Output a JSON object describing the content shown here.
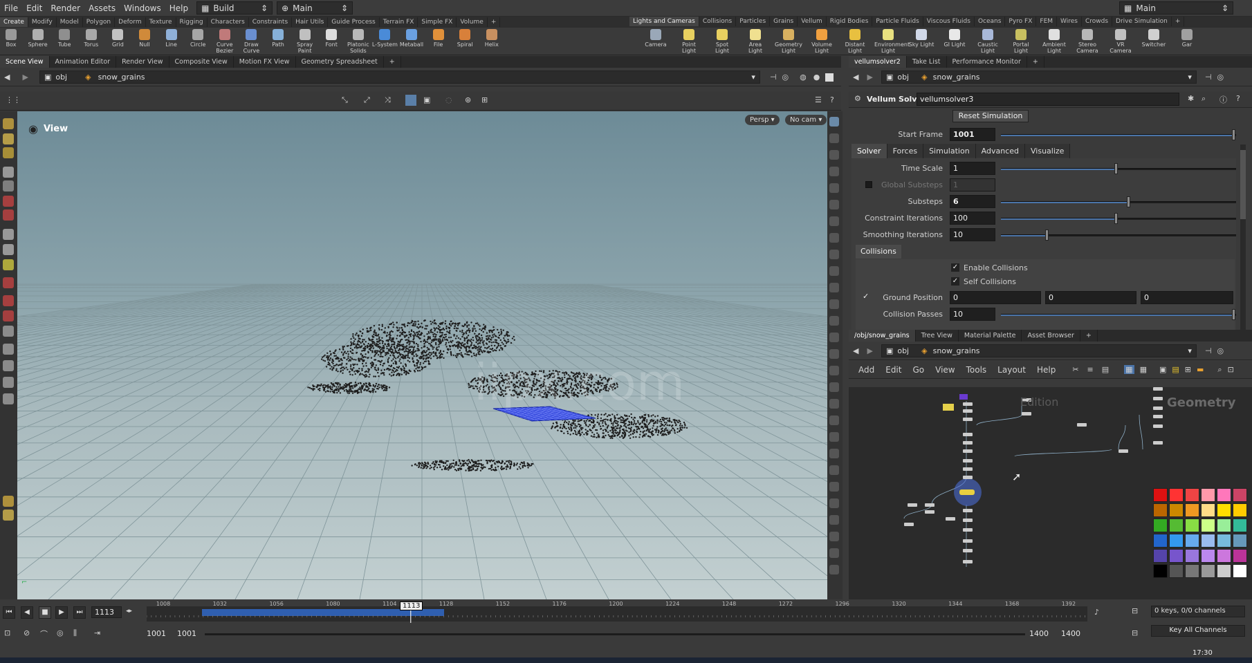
{
  "menubar": {
    "items": [
      "File",
      "Edit",
      "Render",
      "Assets",
      "Windows",
      "Help"
    ],
    "desktop": "Build",
    "session": "Main",
    "right_session": "Main"
  },
  "shelf_left": {
    "tabs": [
      "Create",
      "Modify",
      "Model",
      "Polygon",
      "Deform",
      "Texture",
      "Rigging",
      "Characters",
      "Constraints",
      "Hair Utils",
      "Guide Process",
      "Terrain FX",
      "Simple FX",
      "Volume"
    ],
    "tools": [
      "Box",
      "Sphere",
      "Tube",
      "Torus",
      "Grid",
      "Null",
      "Line",
      "Circle",
      "Curve Bezier",
      "Draw Curve",
      "Path",
      "Spray Paint",
      "Font",
      "Platonic Solids",
      "L-System",
      "Metaball",
      "File",
      "Spiral",
      "Helix"
    ]
  },
  "shelf_right": {
    "tabs": [
      "Lights and Cameras",
      "Collisions",
      "Particles",
      "Grains",
      "Vellum",
      "Rigid Bodies",
      "Particle Fluids",
      "Viscous Fluids",
      "Oceans",
      "Pyro FX",
      "FEM",
      "Wires",
      "Crowds",
      "Drive Simulation"
    ],
    "tools": [
      "Camera",
      "Point Light",
      "Spot Light",
      "Area Light",
      "Geometry Light",
      "Volume Light",
      "Distant Light",
      "Environment Light",
      "Sky Light",
      "GI Light",
      "Caustic Light",
      "Portal Light",
      "Ambient Light",
      "Stereo Camera",
      "VR Camera",
      "Switcher",
      "Gar"
    ]
  },
  "left_panes": {
    "tabs": [
      "Scene View",
      "Animation Editor",
      "Render View",
      "Composite View",
      "Motion FX View",
      "Geometry Spreadsheet"
    ],
    "path_root": "obj",
    "path_node": "snow_grains"
  },
  "viewport": {
    "title": "View",
    "persp": "Persp ▾",
    "cam": "No cam ▾",
    "watermark": "iipx.com"
  },
  "param_pane": {
    "tabs": [
      "vellumsolver2",
      "Take List",
      "Performance Monitor"
    ],
    "path_root": "obj",
    "path_node": "snow_grains",
    "node_type": "Vellum Solver",
    "node_name": "vellumsolver3",
    "reset_button": "Reset Simulation",
    "start_frame_label": "Start Frame",
    "start_frame": "1001",
    "subtabs": [
      "Solver",
      "Forces",
      "Simulation",
      "Advanced",
      "Visualize"
    ],
    "time_scale_label": "Time Scale",
    "time_scale": "1",
    "global_substeps_label": "Global Substeps",
    "global_substeps": "1",
    "substeps_label": "Substeps",
    "substeps": "6",
    "constraint_iter_label": "Constraint Iterations",
    "constraint_iter": "100",
    "smoothing_iter_label": "Smoothing Iterations",
    "smoothing_iter": "10",
    "collisions_tab": "Collisions",
    "enable_collisions": "Enable Collisions",
    "self_collisions": "Self Collisions",
    "ground_position_label": "Ground Position",
    "ground_position": [
      "0",
      "0",
      "0"
    ],
    "collision_passes_label": "Collision Passes",
    "collision_passes": "10"
  },
  "network_pane": {
    "tabs": [
      "/obj/snow_grains",
      "Tree View",
      "Material Palette",
      "Asset Browser"
    ],
    "path_root": "obj",
    "path_node": "snow_grains",
    "menu": [
      "Add",
      "Edit",
      "Go",
      "View",
      "Tools",
      "Layout",
      "Help"
    ],
    "edition": "Edition",
    "context": "Geometry"
  },
  "timeline": {
    "current_frame": "1113",
    "marker": "1113",
    "ticks": [
      "1008",
      "1032",
      "1056",
      "1080",
      "1104",
      "1128",
      "1152",
      "1176",
      "1200",
      "1224",
      "1248",
      "1272",
      "1296",
      "1320",
      "1344",
      "1368",
      "1392"
    ],
    "range_start": "1001",
    "range_start2": "1001",
    "range_end": "1400",
    "range_end2": "1400",
    "keys": "0 keys, 0/0 channels",
    "key_all": "Key All Channels"
  },
  "clock": "17:30",
  "colors": {
    "accent": "#4b74a8",
    "viewport_sky": "#6d8b97",
    "grid_blue": "#2b3fd9"
  }
}
